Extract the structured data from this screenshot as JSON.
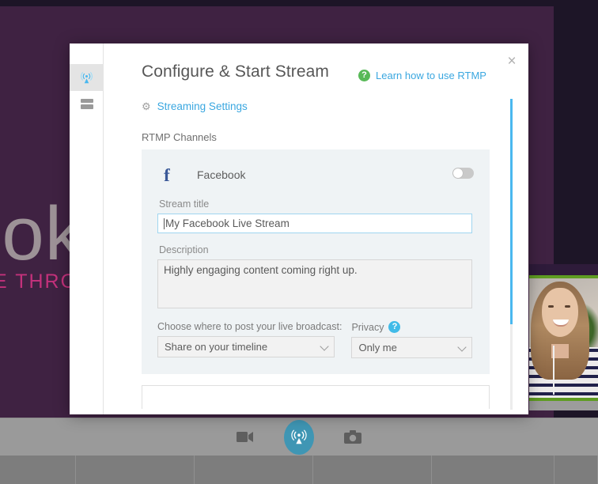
{
  "background": {
    "word_large": "ook",
    "word_small": "CE THRO",
    "purple": "#3f2242",
    "word_color": "#9d9297",
    "sub_color": "#c3317b"
  },
  "toolbar": {
    "video_icon": "video-camera-icon",
    "broadcast_icon": "broadcast-icon",
    "photo_icon": "camera-icon",
    "primary_color": "#3f96b4"
  },
  "dialog": {
    "title": "Configure & Start Stream",
    "close_label": "×",
    "rtmp_help_link": "Learn how to use RTMP",
    "rtmp_help_badge": "?",
    "streaming_settings": "Streaming Settings",
    "section_label": "RTMP Channels",
    "sidebar": [
      {
        "name": "broadcast-icon",
        "active": true
      },
      {
        "name": "layers-icon",
        "active": false
      }
    ]
  },
  "channel": {
    "provider": "Facebook",
    "provider_mark": "f",
    "provider_color": "#3b5998",
    "enabled": false,
    "stream_title_label": "Stream title",
    "stream_title_value": "My Facebook Live Stream",
    "description_label": "Description",
    "description_value": "Highly engaging content coming right up.",
    "post_target_label": "Choose where to post your live broadcast:",
    "post_target_value": "Share on your timeline",
    "privacy_label": "Privacy",
    "privacy_badge": "?",
    "privacy_value": "Only me"
  }
}
